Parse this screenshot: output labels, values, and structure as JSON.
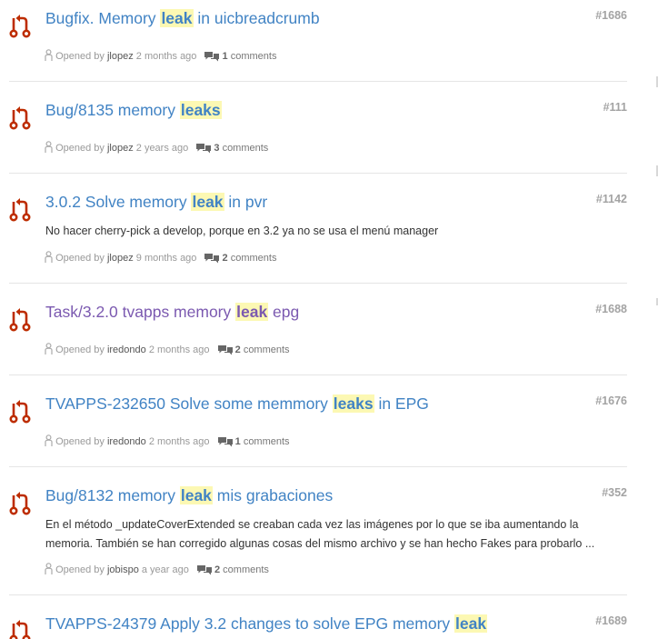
{
  "results": [
    {
      "title_pre": "Bugfix. Memory ",
      "title_hl": "leak",
      "title_post": " in uicbreadcrumb",
      "number": "#1686",
      "description": "",
      "opened_by": "Opened by",
      "author": "jlopez",
      "time": "2 months ago",
      "comments_count": "1",
      "comments_word": "comments"
    },
    {
      "title_pre": "Bug/8135 memory ",
      "title_hl": "leaks",
      "title_post": "",
      "number": "#111",
      "description": "",
      "opened_by": "Opened by",
      "author": "jlopez",
      "time": "2 years ago",
      "comments_count": "3",
      "comments_word": "comments"
    },
    {
      "title_pre": "3.0.2 Solve memory ",
      "title_hl": "leak",
      "title_post": " in pvr",
      "number": "#1142",
      "description": "No hacer cherry-pick a develop, porque en 3.2 ya no se usa el menú manager",
      "opened_by": "Opened by",
      "author": "jlopez",
      "time": "9 months ago",
      "comments_count": "2",
      "comments_word": "comments"
    },
    {
      "title_pre": "Task/3.2.0 tvapps memory ",
      "title_hl": "leak",
      "title_post": " epg",
      "number": "#1688",
      "description": "",
      "opened_by": "Opened by",
      "author": "iredondo",
      "time": "2 months ago",
      "comments_count": "2",
      "comments_word": "comments"
    },
    {
      "title_pre": "TVAPPS-232650 Solve some memmory ",
      "title_hl": "leaks",
      "title_post": " in EPG",
      "number": "#1676",
      "description": "",
      "opened_by": "Opened by",
      "author": "iredondo",
      "time": "2 months ago",
      "comments_count": "1",
      "comments_word": "comments"
    },
    {
      "title_pre": "Bug/8132 memory ",
      "title_hl": "leak",
      "title_post": " mis grabaciones",
      "number": "#352",
      "description": "En el método _updateCoverExtended se creaban cada vez las imágenes por lo que se iba aumentando la memoria. También se han corregido algunas cosas del mismo archivo y se han hecho Fakes para probarlo ...",
      "opened_by": "Opened by",
      "author": "jobispo",
      "time": "a year ago",
      "comments_count": "2",
      "comments_word": "comments"
    },
    {
      "title_pre": "TVAPPS-24379 Apply 3.2 changes to solve EPG memory ",
      "title_hl": "leak",
      "title_post": "",
      "number": "#1689",
      "description": "",
      "opened_by": "",
      "author": "",
      "time": "",
      "comments_count": "",
      "comments_word": ""
    }
  ],
  "colors": {
    "link": "#4183c4",
    "visited_link": "#7b59b0",
    "highlight": "#fcf8b3",
    "pr_icon": "#bd2c00",
    "meta": "#999999"
  },
  "icons": {
    "pr": "git-pull-request-icon",
    "person": "person-icon",
    "comments": "comment-discussion-icon"
  }
}
